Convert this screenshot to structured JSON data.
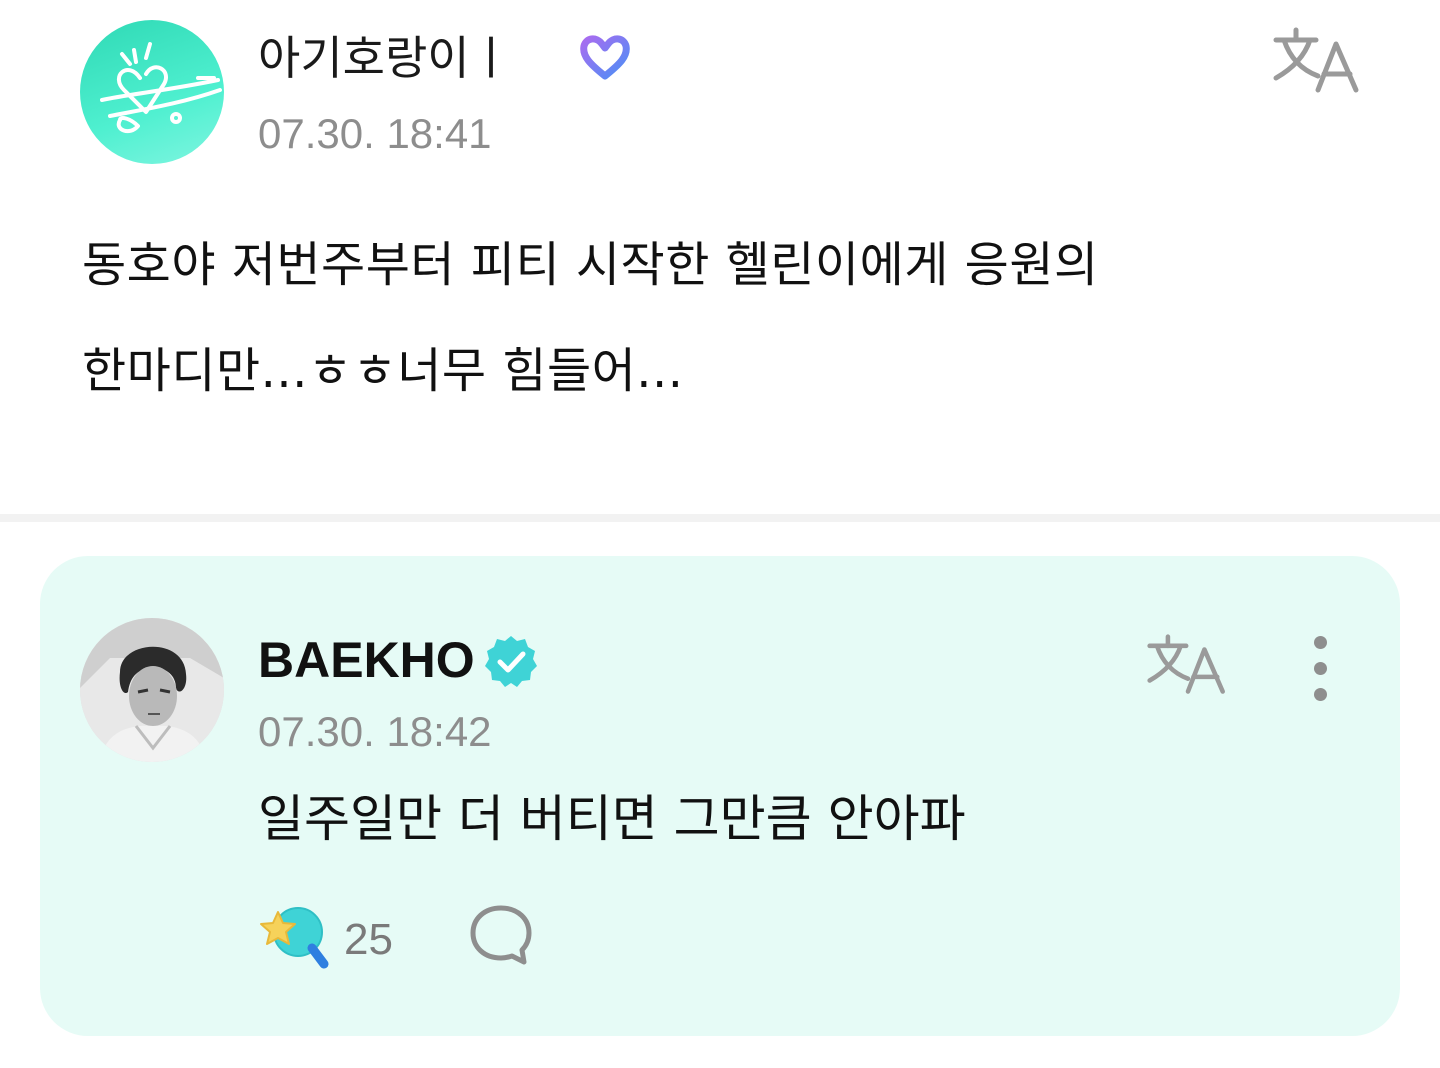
{
  "post": {
    "author": "아기호랑이ㅣ",
    "date": "07.30. 18:41",
    "body": "동호야 저번주부터 피티 시작한 헬린이에게 응원의\n한마디만...ㅎㅎ너무 힘들어..."
  },
  "reply": {
    "author": "BAEKHO",
    "date": "07.30. 18:42",
    "text": "일주일만 더 버티면 그만큼 안아파",
    "like_count": "25"
  },
  "icons": {
    "fan_badge": "heart-badge-icon",
    "verified": "verified-badge-icon",
    "translate": "translate-icon",
    "more": "more-vertical-icon",
    "like": "star-lightstick-icon",
    "comment": "comment-bubble-icon"
  },
  "colors": {
    "reply_background": "#e6fbf6",
    "verified": "#3fd3d6",
    "fan_avatar": "#3ee6c3",
    "meta_text": "#8d8d8d"
  }
}
